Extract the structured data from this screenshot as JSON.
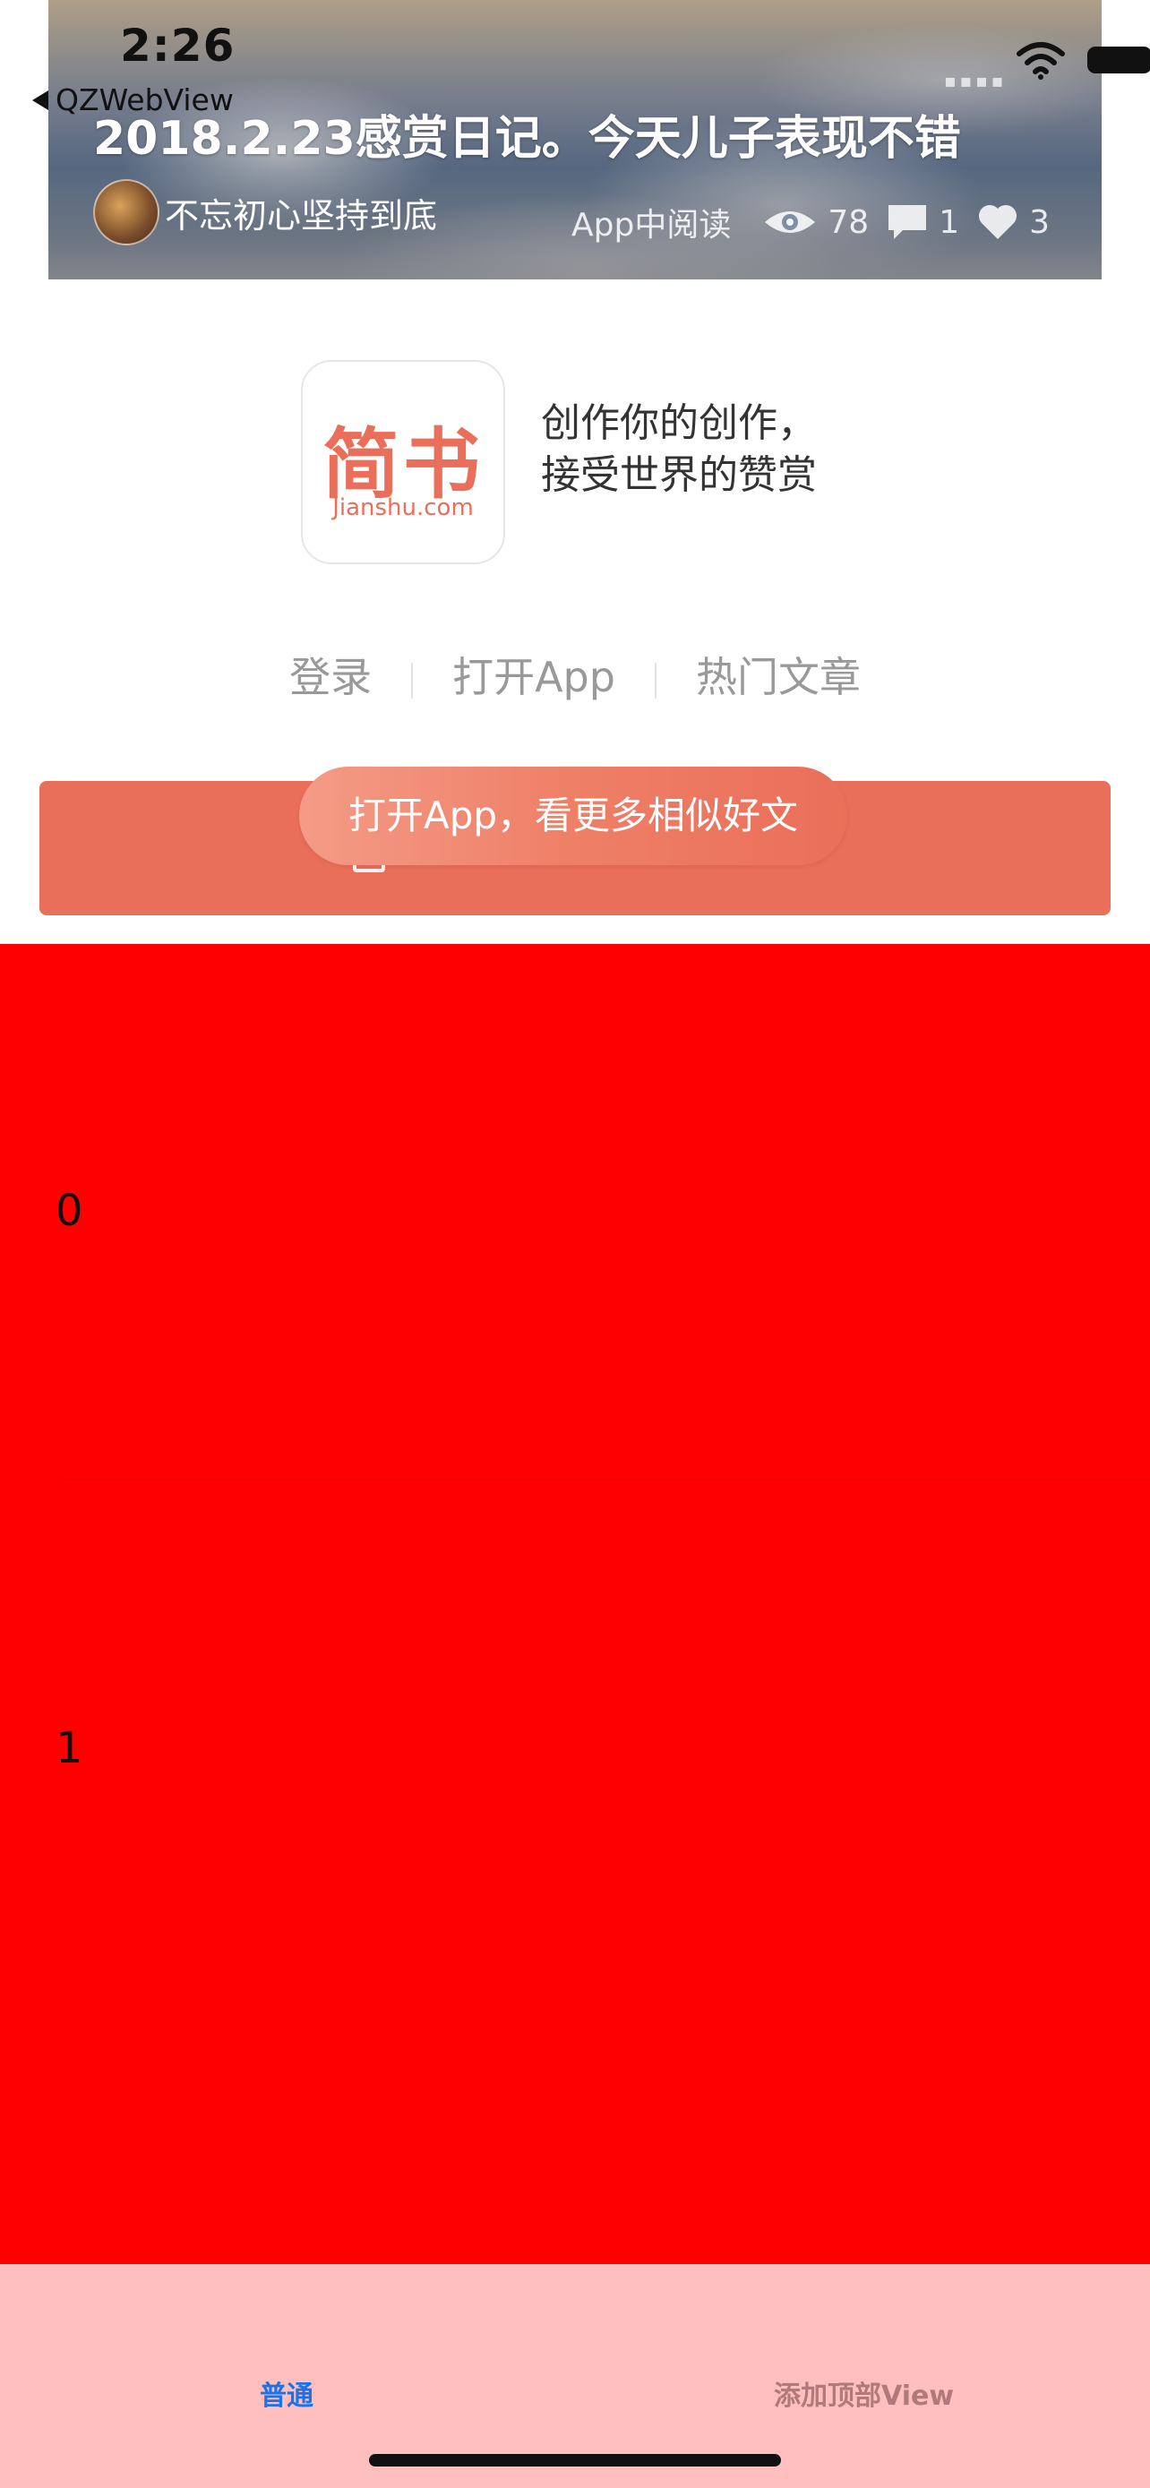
{
  "status_bar": {
    "time": "2:26"
  },
  "nav": {
    "back_label": "QZWebView"
  },
  "article": {
    "title": "2018.2.23感赏日记。今天儿子表现不错",
    "author": "不忘初心坚持到底",
    "read_in_app": "App中阅读",
    "views": "78",
    "comments": "1",
    "likes": "3"
  },
  "promo": {
    "logo_main": "简书",
    "logo_sub": "Jianshu.com",
    "slogan_line1": "创作你的创作，",
    "slogan_line2": "接受世界的赞赏"
  },
  "links": {
    "login": "登录",
    "open_app": "打开App",
    "hot_articles": "热门文章"
  },
  "cta": {
    "pill_label": "打开App，看更多相似好文"
  },
  "list": {
    "rows": [
      "0",
      "1"
    ]
  },
  "tabbar": {
    "tab_normal": "普通",
    "tab_add_top_view": "添加顶部View"
  },
  "colors": {
    "brand": "#ea6f5a",
    "list_bg": "#ff0000",
    "tabbar_bg": "#ffbfbf",
    "active_tab": "#1a73e8"
  }
}
